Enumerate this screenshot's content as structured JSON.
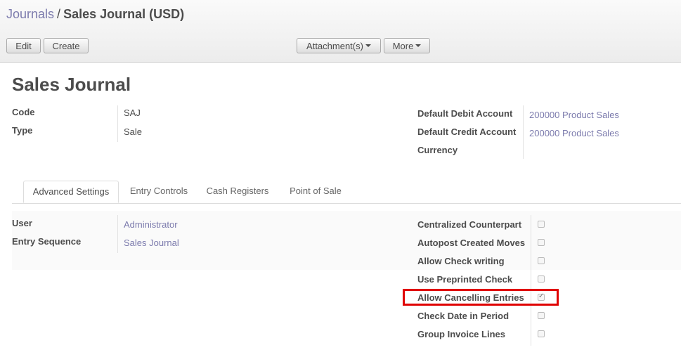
{
  "breadcrumb": {
    "parent": "Journals",
    "separator": "/",
    "current": "Sales Journal (USD)"
  },
  "toolbar": {
    "edit": "Edit",
    "create": "Create",
    "attachments": "Attachment(s)",
    "more": "More"
  },
  "form": {
    "title": "Sales Journal",
    "left": [
      {
        "label": "Code",
        "value": "SAJ"
      },
      {
        "label": "Type",
        "value": "Sale"
      }
    ],
    "right": [
      {
        "label": "Default Debit Account",
        "value": "200000 Product Sales"
      },
      {
        "label": "Default Credit Account",
        "value": "200000 Product Sales"
      },
      {
        "label": "Currency",
        "value": ""
      }
    ]
  },
  "tabs": [
    "Advanced Settings",
    "Entry Controls",
    "Cash Registers",
    "Point of Sale"
  ],
  "advanced": {
    "left": [
      {
        "label": "User",
        "value": "Administrator"
      },
      {
        "label": "Entry Sequence",
        "value": "Sales Journal"
      }
    ],
    "checks": [
      {
        "label": "Centralized Counterpart",
        "checked": false
      },
      {
        "label": "Autopost Created Moves",
        "checked": false
      },
      {
        "label": "Allow Check writing",
        "checked": false
      },
      {
        "label": "Use Preprinted Check",
        "checked": false
      },
      {
        "label": "Allow Cancelling Entries",
        "checked": true
      },
      {
        "label": "Check Date in Period",
        "checked": false
      },
      {
        "label": "Group Invoice Lines",
        "checked": false
      }
    ]
  },
  "colors": {
    "link": "#7c7bad",
    "highlight": "#e00000"
  }
}
